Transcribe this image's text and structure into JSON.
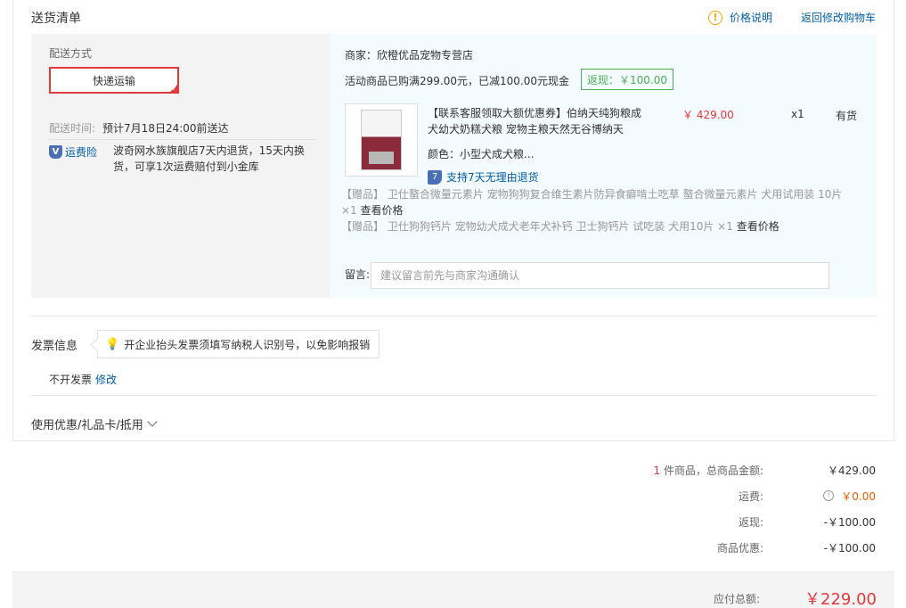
{
  "section_title": "送货清单",
  "header": {
    "price_note_label": "价格说明",
    "back_to_cart_label": "返回修改购物车"
  },
  "shipping": {
    "method_label": "配送方式",
    "method_selected": "快递运输",
    "time_label": "配送时间:",
    "time_value": "预计7月18日24:00前送达",
    "insurance_label": "运费险",
    "insurance_desc": "波奇网水族旗舰店7天内退货，15天内换货，可享1次运费赔付到小金库"
  },
  "order": {
    "merchant": "商家：欣橙优品宠物专营店",
    "promo_text": "活动商品已购满299.00元，已减100.00元现金",
    "cashback_label": "返现：￥100.00",
    "product": {
      "title": "【联系客服领取大额优惠券】伯纳天纯狗粮成犬幼犬奶糕犬粮 宠物主粮天然无谷博纳天",
      "price": "￥ 429.00",
      "qty": "x1",
      "stock": "有货",
      "color": "颜色：小型犬成犬粮...",
      "return_support": "支持7天无理由退货"
    },
    "gifts": [
      {
        "text": "【赠品】 卫仕螯合微量元素片 宠物狗狗复合维生素片防异食癖啃土吃草 螯合微量元素片 犬用试用装 10片 ×1",
        "view_label": "查看价格"
      },
      {
        "text": "【赠品】 卫仕狗狗钙片 宠物幼犬成犬老年犬补钙 卫士狗钙片 试吃装 犬用10片 ×1",
        "view_label": "查看价格"
      }
    ],
    "remark_label": "留言:",
    "remark_placeholder": "建议留言前先与商家沟通确认"
  },
  "invoice": {
    "title": "发票信息",
    "tip": "开企业抬头发票须填写纳税人识别号，以免影响报销",
    "status": "不开发票",
    "edit_label": "修改"
  },
  "discount_label": "使用优惠/礼品卡/抵用",
  "summary": {
    "item_count": "1",
    "item_total_label": "件商品，总商品金额:",
    "item_total_value": "￥429.00",
    "freight_label": "运费:",
    "freight_value": "￥0.00",
    "cashback_label": "返现:",
    "cashback_value": "-￥100.00",
    "discount_label": "商品优惠:",
    "discount_value": "-￥100.00",
    "payable_label": "应付总额:",
    "payable_value": "￥229.00"
  },
  "colors": {
    "accent_red": "#e4393c",
    "link_blue": "#005ea7",
    "cashback_green": "#4caf50",
    "freight_orange": "#f05a00"
  }
}
